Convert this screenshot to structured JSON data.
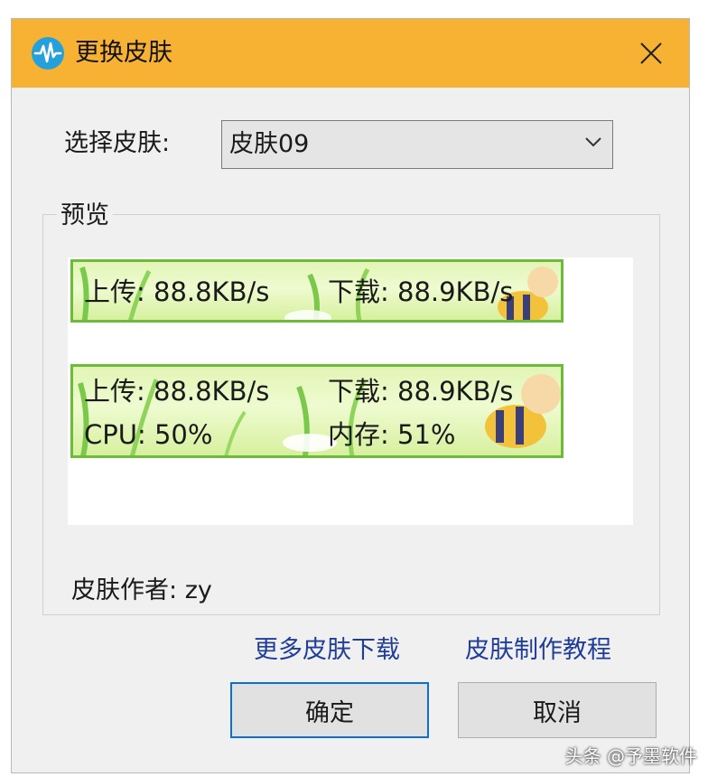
{
  "window": {
    "title": "更换皮肤",
    "icon": "waveform-icon",
    "title_bar_color": "#f7b233",
    "close_icon": "close-icon"
  },
  "skin_select": {
    "label": "选择皮肤:",
    "value": "皮肤09"
  },
  "preview": {
    "legend": "预览",
    "skin_a": {
      "upload": "上传: 88.8KB/s",
      "download": "下载: 88.9KB/s"
    },
    "skin_b": {
      "upload": "上传: 88.8KB/s",
      "download": "下载: 88.9KB/s",
      "cpu": "CPU: 50%",
      "memory": "内存: 51%"
    },
    "accent_border": "#6cbc3a"
  },
  "author": {
    "label": "皮肤作者:",
    "value": "zy"
  },
  "links": {
    "more_skins": "更多皮肤下载",
    "tutorial": "皮肤制作教程"
  },
  "buttons": {
    "ok": "确定",
    "cancel": "取消"
  },
  "watermark": "头条 @予墨软件"
}
